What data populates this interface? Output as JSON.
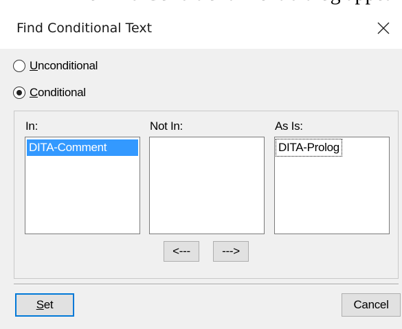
{
  "backdrop": {
    "text": "The Find Conditional Text dialog appears"
  },
  "dialog": {
    "title": "Find Conditional Text",
    "close_glyph": "close-icon"
  },
  "options": {
    "unconditional": {
      "label_accel": "U",
      "label_rest": "nconditional",
      "checked": false
    },
    "conditional": {
      "label_accel": "C",
      "label_rest": "onditional",
      "checked": true
    }
  },
  "columns": {
    "in": {
      "label": "In:",
      "items": [
        "DITA-Comment"
      ]
    },
    "not_in": {
      "label": "Not In:",
      "items": []
    },
    "as_is": {
      "label": "As Is:",
      "items": [
        "DITA-Prolog"
      ]
    }
  },
  "move_buttons": {
    "left": "<---",
    "right": "--->"
  },
  "footer": {
    "set_accel": "S",
    "set_rest": "et",
    "cancel": "Cancel"
  },
  "colors": {
    "selection": "#3399ff",
    "default_button_border": "#0078d7",
    "dialog_background": "#f0f0f0"
  }
}
